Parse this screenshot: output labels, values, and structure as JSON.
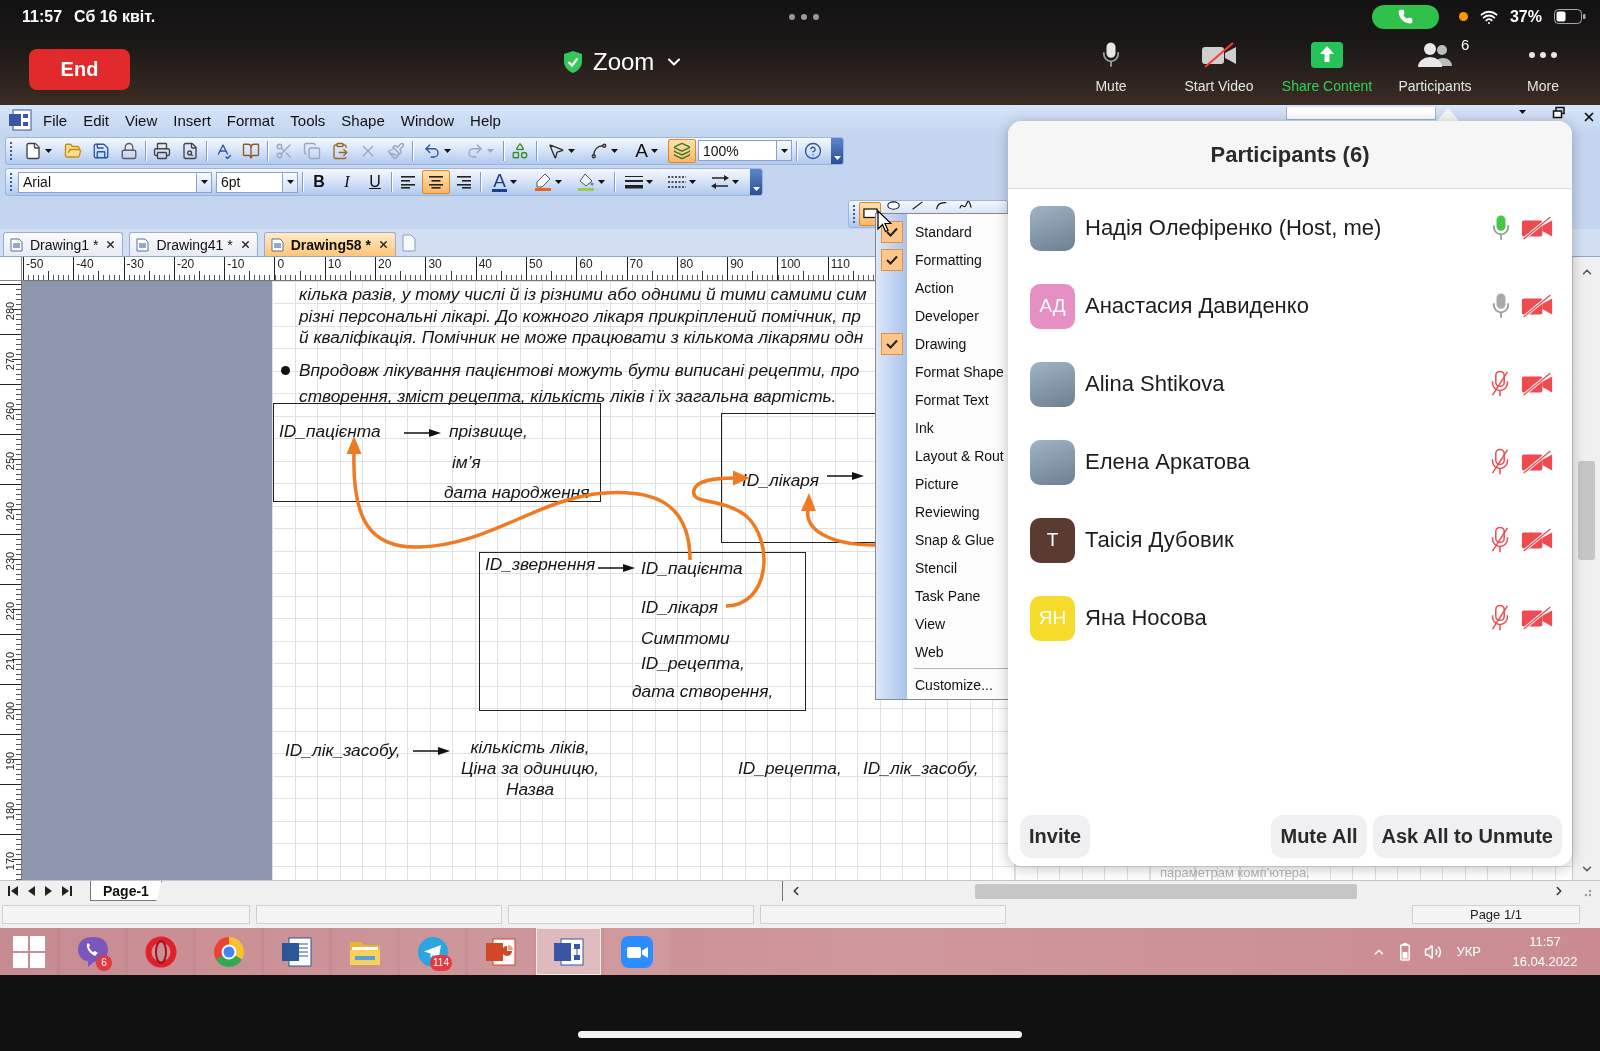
{
  "status_bar": {
    "time": "11:57",
    "date": "Сб 16 квіт.",
    "battery": "37%"
  },
  "zoom_bar": {
    "end_button": "End",
    "title": "Zoom",
    "controls": [
      {
        "kind": "mic",
        "label": "Mute"
      },
      {
        "kind": "video",
        "label": "Start Video"
      },
      {
        "kind": "share",
        "label": "Share Content"
      },
      {
        "kind": "participants",
        "label": "Participants",
        "badge": "6"
      },
      {
        "kind": "more",
        "label": "More"
      }
    ]
  },
  "visio": {
    "menu": [
      "File",
      "Edit",
      "View",
      "Insert",
      "Format",
      "Tools",
      "Shape",
      "Window",
      "Help"
    ],
    "standard_toolbar": {
      "groups": [
        [
          {
            "kind": "new",
            "dropdown": true,
            "disabled": false,
            "on": false
          },
          {
            "kind": "open",
            "dropdown": false,
            "disabled": false,
            "on": false
          },
          {
            "kind": "save",
            "dropdown": false,
            "disabled": false,
            "on": false
          },
          {
            "kind": "permission",
            "dropdown": false,
            "disabled": false,
            "on": false
          }
        ],
        [
          {
            "kind": "print",
            "dropdown": false,
            "disabled": false,
            "on": false
          },
          {
            "kind": "preview",
            "dropdown": false,
            "disabled": false,
            "on": false
          }
        ],
        [
          {
            "kind": "spelling",
            "dropdown": false,
            "disabled": false,
            "on": false
          },
          {
            "kind": "research",
            "dropdown": false,
            "disabled": false,
            "on": false
          }
        ],
        [
          {
            "kind": "cut",
            "dropdown": false,
            "disabled": true,
            "on": false
          },
          {
            "kind": "copy",
            "dropdown": false,
            "disabled": true,
            "on": false
          },
          {
            "kind": "paste",
            "dropdown": false,
            "disabled": false,
            "on": false
          },
          {
            "kind": "delete",
            "dropdown": false,
            "disabled": true,
            "on": false
          },
          {
            "kind": "painter",
            "dropdown": false,
            "disabled": true,
            "on": false
          }
        ],
        [
          {
            "kind": "undo",
            "dropdown": true,
            "disabled": false,
            "on": false
          },
          {
            "kind": "redo",
            "dropdown": true,
            "disabled": true,
            "on": false
          }
        ],
        [
          {
            "kind": "stencil",
            "dropdown": false,
            "disabled": false,
            "on": false
          }
        ],
        [
          {
            "kind": "pointer",
            "dropdown": true,
            "disabled": false,
            "on": false
          },
          {
            "kind": "connector",
            "dropdown": true,
            "disabled": false,
            "on": false
          },
          {
            "kind": "text",
            "label": "A",
            "dropdown": true,
            "disabled": false,
            "on": false
          },
          {
            "kind": "shapes",
            "dropdown": false,
            "disabled": false,
            "on": true
          },
          {
            "kind": "zoom",
            "value": "100%",
            "dropdown": true,
            "disabled": false,
            "on": false
          }
        ],
        [
          {
            "kind": "help",
            "dropdown": false,
            "disabled": false,
            "on": false
          }
        ]
      ]
    },
    "formatting_toolbar": {
      "groups": [
        [
          {
            "kind": "font",
            "value": "Arial",
            "dropdown": true,
            "disabled": false,
            "on": false
          },
          {
            "kind": "size",
            "value": "6pt",
            "dropdown": true,
            "disabled": false,
            "on": false
          }
        ],
        [
          {
            "kind": "bold",
            "label": "B",
            "dropdown": false,
            "disabled": false,
            "on": false
          },
          {
            "kind": "italic",
            "label": "I",
            "dropdown": false,
            "disabled": false,
            "on": false
          },
          {
            "kind": "underline",
            "label": "U",
            "dropdown": false,
            "disabled": false,
            "on": false
          }
        ],
        [
          {
            "kind": "align_left",
            "dropdown": false,
            "disabled": false,
            "on": false
          },
          {
            "kind": "align_center",
            "dropdown": false,
            "disabled": false,
            "on": true
          },
          {
            "kind": "align_right",
            "dropdown": false,
            "disabled": false,
            "on": false
          }
        ],
        [
          {
            "kind": "font_color",
            "label": "A",
            "dropdown": true,
            "disabled": false,
            "on": false
          },
          {
            "kind": "line_color",
            "dropdown": true,
            "disabled": false,
            "on": false
          },
          {
            "kind": "fill_color",
            "dropdown": true,
            "disabled": false,
            "on": false
          }
        ],
        [
          {
            "kind": "line_weight",
            "dropdown": true,
            "disabled": false,
            "on": false
          },
          {
            "kind": "line_pattern",
            "dropdown": true,
            "disabled": false,
            "on": false
          },
          {
            "kind": "line_ends",
            "dropdown": true,
            "disabled": false,
            "on": false
          }
        ]
      ]
    },
    "drawing_toolbar": {
      "tools": [
        {
          "kind": "rectangle",
          "selected": true
        },
        {
          "kind": "ellipse",
          "selected": false
        },
        {
          "kind": "line",
          "selected": false
        },
        {
          "kind": "arc",
          "selected": false
        },
        {
          "kind": "freeform",
          "selected": false
        }
      ]
    },
    "toolbars_menu": {
      "items": [
        {
          "label": "Standard",
          "checked": true
        },
        {
          "label": "Formatting",
          "checked": true
        },
        {
          "label": "Action",
          "checked": false
        },
        {
          "label": "Developer",
          "checked": false
        },
        {
          "label": "Drawing",
          "checked": true
        },
        {
          "label": "Format Shape",
          "checked": false
        },
        {
          "label": "Format Text",
          "checked": false
        },
        {
          "label": "Ink",
          "checked": false
        },
        {
          "label": "Layout & Rout",
          "checked": false
        },
        {
          "label": "Picture",
          "checked": false
        },
        {
          "label": "Reviewing",
          "checked": false
        },
        {
          "label": "Snap & Glue",
          "checked": false
        },
        {
          "label": "Stencil",
          "checked": false
        },
        {
          "label": "Task Pane",
          "checked": false
        },
        {
          "label": "View",
          "checked": false
        },
        {
          "label": "Web",
          "checked": false
        }
      ],
      "customize": "Customize..."
    },
    "tabs": [
      {
        "label": "Drawing1 *",
        "selected": false
      },
      {
        "label": "Drawing41 *",
        "selected": false
      },
      {
        "label": "Drawing58 *",
        "selected": true
      }
    ],
    "ruler": {
      "horizontal": [
        "-50",
        "-40",
        "-30",
        "-20",
        "-10",
        "0",
        "10",
        "20",
        "30",
        "40",
        "50",
        "60",
        "70",
        "80",
        "90",
        "100",
        "110"
      ],
      "vertical": [
        "280",
        "270",
        "260",
        "250",
        "240",
        "230",
        "220",
        "210",
        "200",
        "190",
        "180",
        "170"
      ]
    },
    "page": {
      "text_lines": [
        "кілька разів, у тому числі й із різними або одними й тими самими сим",
        "різні персональні лікарі. До кожного лікаря прикріплений помічник, пр",
        "й кваліфікація. Помічник не може працювати з кількома лікарями одн"
      ],
      "bullet_lines": [
        "Впродовж лікування пацієнтові можуть бути виписані рецепти, про",
        "створення, зміст рецепта, кількість ліків і їх загальна вартість."
      ],
      "boxes": [
        {
          "key": "ID_пацієнта",
          "fields": [
            "прізвище,",
            "ім’я",
            "дата народження"
          ]
        },
        {
          "key": "ID_лікаря"
        },
        {
          "key": "ID_звернення",
          "fields": [
            "ID_пацієнта",
            "ID_лікаря",
            "Симптоми",
            "ID_рецепта,",
            "дата створення,"
          ]
        }
      ],
      "mapping": {
        "key": "ID_лік_засобу,",
        "fields": [
          "кількість ліків,",
          "Ціна за одиницю,",
          "Назва"
        ]
      },
      "loose_labels": [
        "ID_рецепта,",
        "ID_лік_засобу,"
      ],
      "footer_fragment": "параметрам комп’ютера."
    },
    "page_tab": "Page-1",
    "status": "Page 1/1"
  },
  "participants": {
    "title": "Participants (6)",
    "list": [
      {
        "name": "Надія Олефіренко (Host, me)",
        "avatar": {
          "kind": "photo"
        },
        "muted": false,
        "speaking": true,
        "video_on": false
      },
      {
        "name": "Анастасия Давиденко",
        "avatar": {
          "kind": "initials",
          "text": "АД",
          "color": "#e58fc2"
        },
        "muted": false,
        "speaking": false,
        "video_on": false
      },
      {
        "name": "Alina Shtikova",
        "avatar": {
          "kind": "photo"
        },
        "muted": true,
        "speaking": false,
        "video_on": false
      },
      {
        "name": "Елена Аркатова",
        "avatar": {
          "kind": "photo"
        },
        "muted": true,
        "speaking": false,
        "video_on": false
      },
      {
        "name": "Таісія Дубовик",
        "avatar": {
          "kind": "initials",
          "text": "Т",
          "color": "#5b3a2f"
        },
        "muted": true,
        "speaking": false,
        "video_on": false
      },
      {
        "name": "Яна Носова",
        "avatar": {
          "kind": "initials",
          "text": "ЯН",
          "color": "#f6dc2a"
        },
        "muted": true,
        "speaking": false,
        "video_on": false
      }
    ],
    "buttons": [
      "Invite",
      "Mute All",
      "Ask All to Unmute"
    ]
  },
  "taskbar": {
    "apps": [
      {
        "kind": "start",
        "selected": false
      },
      {
        "kind": "phone",
        "badge": "6",
        "selected": false
      },
      {
        "kind": "ring",
        "selected": false
      },
      {
        "kind": "wheel",
        "selected": false
      },
      {
        "kind": "document",
        "selected": false
      },
      {
        "kind": "folder",
        "selected": false
      },
      {
        "kind": "plane",
        "badge": "114",
        "selected": false
      },
      {
        "kind": "slides",
        "selected": false
      },
      {
        "kind": "diagram",
        "selected": true
      },
      {
        "kind": "camera",
        "selected": false
      }
    ],
    "tray": {
      "language": "УКР",
      "time": "11:57",
      "date": "16.04.2022"
    }
  }
}
